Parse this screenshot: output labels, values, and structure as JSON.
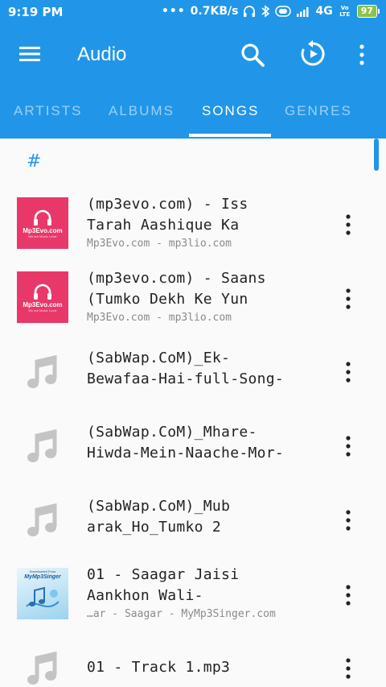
{
  "status_bar": {
    "time": "9:19 PM",
    "network_speed": "0.7KB/s",
    "network_type": "4G",
    "volte": "Vo LTE",
    "battery": "97"
  },
  "app_bar": {
    "title": "Audio",
    "icons": [
      "menu-icon",
      "search-icon",
      "shuffle-icon",
      "more-vert-icon"
    ]
  },
  "tabs": [
    {
      "label": "ARTISTS",
      "active": false
    },
    {
      "label": "ALBUMS",
      "active": false
    },
    {
      "label": "SONGS",
      "active": true
    },
    {
      "label": "GENRES",
      "active": false
    }
  ],
  "section_header": "#",
  "songs": [
    {
      "title_line1": "(mp3evo.com) - Iss",
      "title_line2": "Tarah Aashique Ka",
      "subtitle": "Mp3Evo.com - mp3lio.com",
      "thumb": "mp3evo",
      "thumb_brand": "Mp3Evo.com",
      "thumb_tag": "We are Music Lover"
    },
    {
      "title_line1": "(mp3evo.com) - Saans",
      "title_line2": "(Tumko Dekh Ke Yun",
      "subtitle": "Mp3Evo.com - mp3lio.com",
      "thumb": "mp3evo",
      "thumb_brand": "Mp3Evo.com",
      "thumb_tag": "We are Music Lover"
    },
    {
      "title_line1": "(SabWap.CoM)_Ek-",
      "title_line2": "Bewafaa-Hai-full-Song-",
      "subtitle": "",
      "thumb": "note"
    },
    {
      "title_line1": "(SabWap.CoM)_Mhare-",
      "title_line2": "Hiwda-Mein-Naache-Mor-",
      "subtitle": "",
      "thumb": "note"
    },
    {
      "title_line1": "(SabWap.CoM)_Mub",
      "title_line2": "arak_Ho_Tumko 2",
      "subtitle": "",
      "thumb": "note"
    },
    {
      "title_line1": "01 - Saagar Jaisi",
      "title_line2": "Aankhon Wali-",
      "subtitle": "…ar - Saagar - MyMp3Singer.com",
      "thumb": "mymp3singer",
      "thumb_dl": "Downloaded From",
      "thumb_site": "MyMp3Singer"
    },
    {
      "title_line1": "01 - Track 1.mp3",
      "title_line2": "",
      "subtitle": "",
      "thumb": "note"
    }
  ],
  "colors": {
    "primary": "#2196e8",
    "mp3evo_pink": "#e8386a",
    "note_gray": "#c4c4c4"
  }
}
